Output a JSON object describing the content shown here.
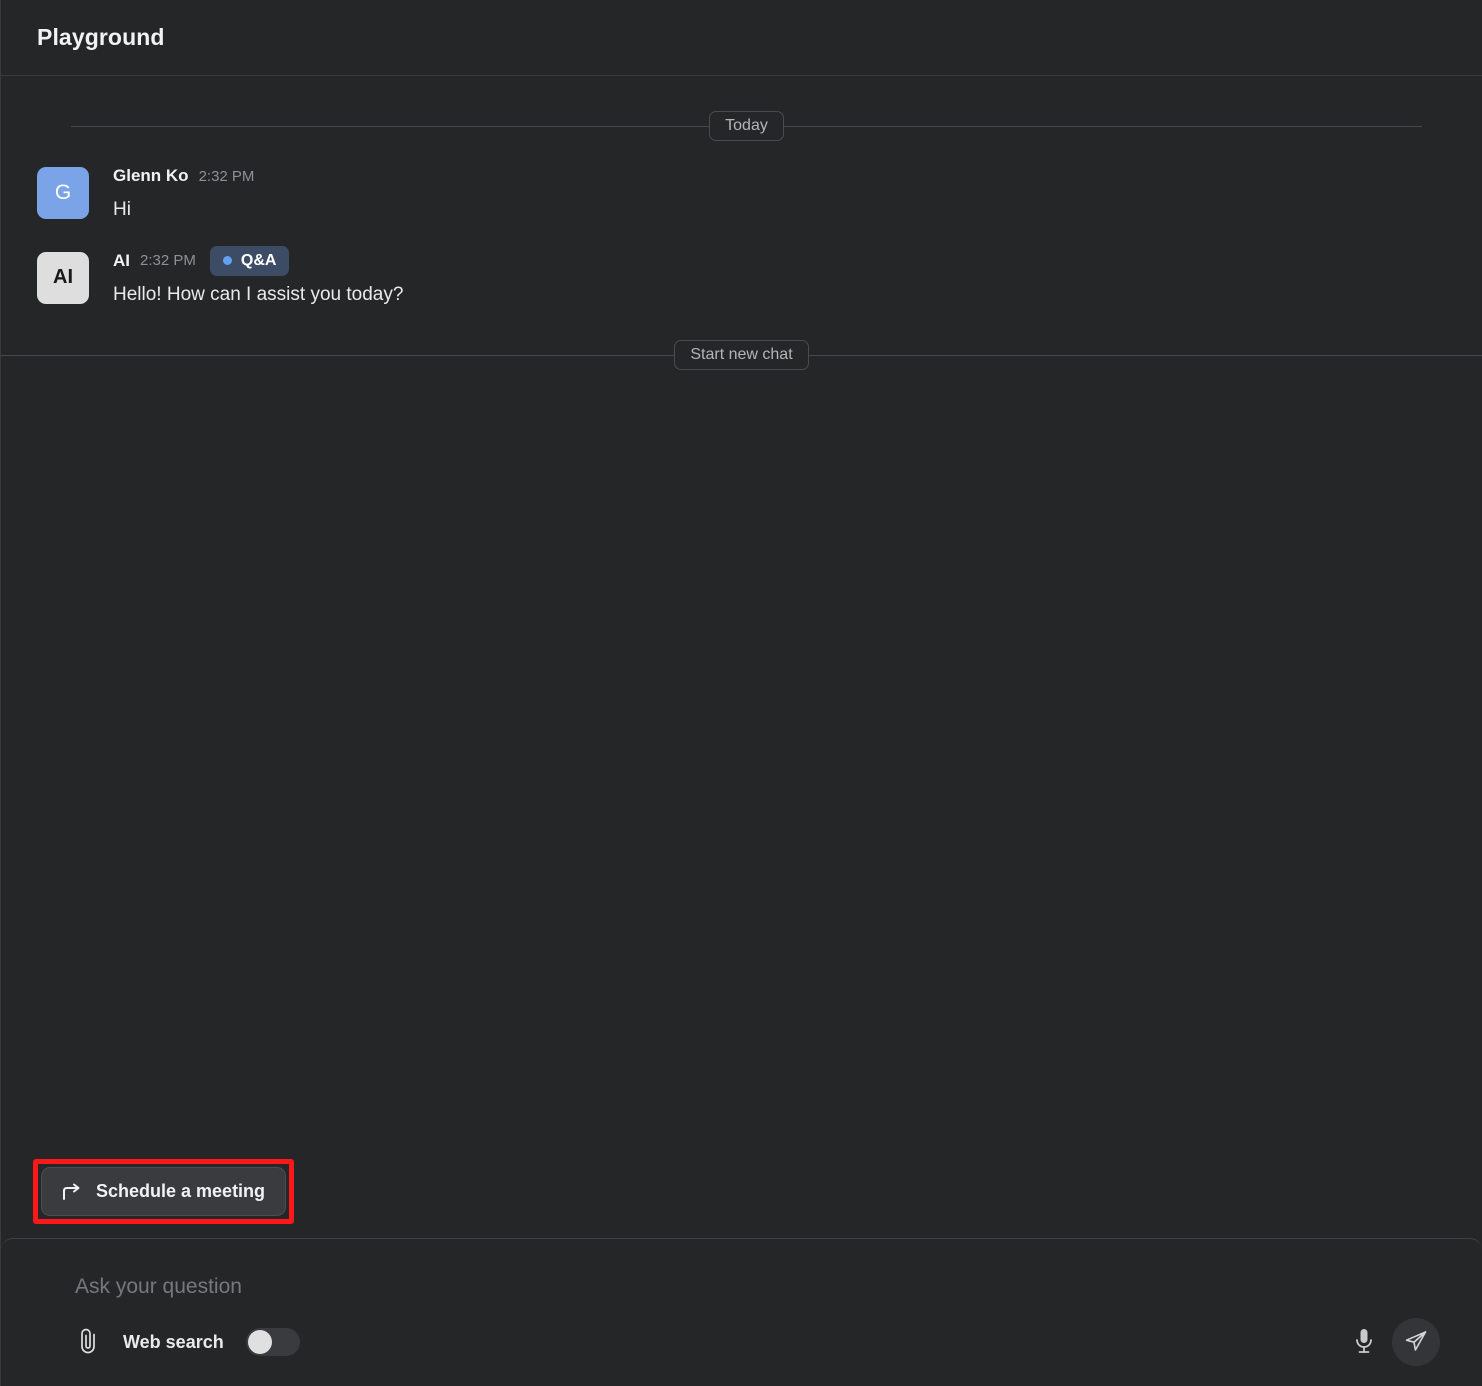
{
  "header": {
    "title": "Playground"
  },
  "conversation": {
    "date_divider_label": "Today",
    "new_chat_divider_label": "Start new chat",
    "messages": [
      {
        "avatar_initial": "G",
        "avatar_type": "user",
        "author": "Glenn Ko",
        "time": "2:32 PM",
        "badge": null,
        "text": "Hi"
      },
      {
        "avatar_initial": "AI",
        "avatar_type": "ai",
        "author": "AI",
        "time": "2:32 PM",
        "badge": "Q&A",
        "text": "Hello! How can I assist you today?"
      }
    ]
  },
  "suggestions": {
    "schedule_meeting_label": "Schedule a meeting"
  },
  "composer": {
    "input_value": "",
    "input_placeholder": "Ask your question",
    "web_search_label": "Web search",
    "web_search_enabled": false
  },
  "colors": {
    "background": "#252628",
    "accent_blue": "#7aa3e8",
    "badge_bg": "#3d4c65",
    "badge_dot": "#62a0f0",
    "highlight": "#fb1818",
    "border": "#3a3b3d"
  }
}
